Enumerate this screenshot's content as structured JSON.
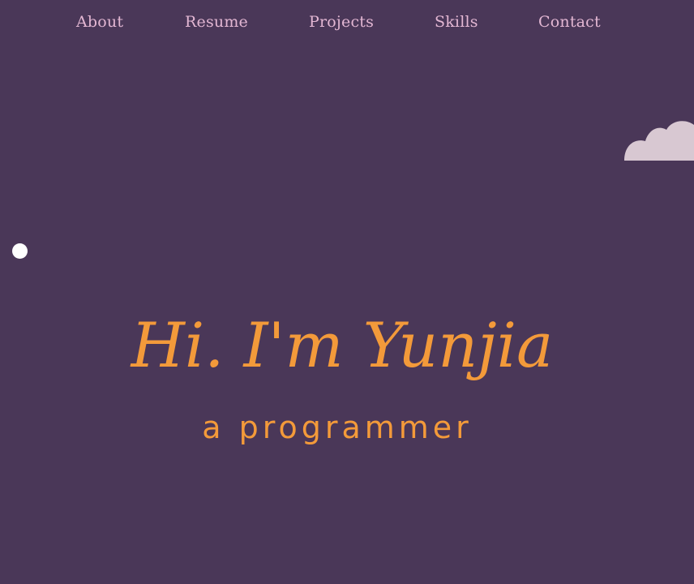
{
  "nav": {
    "items": [
      {
        "label": "About"
      },
      {
        "label": "Resume"
      },
      {
        "label": "Projects"
      },
      {
        "label": "Skills"
      },
      {
        "label": "Contact"
      }
    ]
  },
  "hero": {
    "title": "Hi. I'm Yunjia",
    "subtitle": "a programmer"
  },
  "colors": {
    "background": "#4a3758",
    "nav_text": "#e3b7d3",
    "accent": "#f39a3a",
    "cloud": "#d8c8d2",
    "dot": "#ffffff"
  },
  "decorations": {
    "cloud_icon": "cloud-icon",
    "dot_icon": "circle-icon"
  }
}
